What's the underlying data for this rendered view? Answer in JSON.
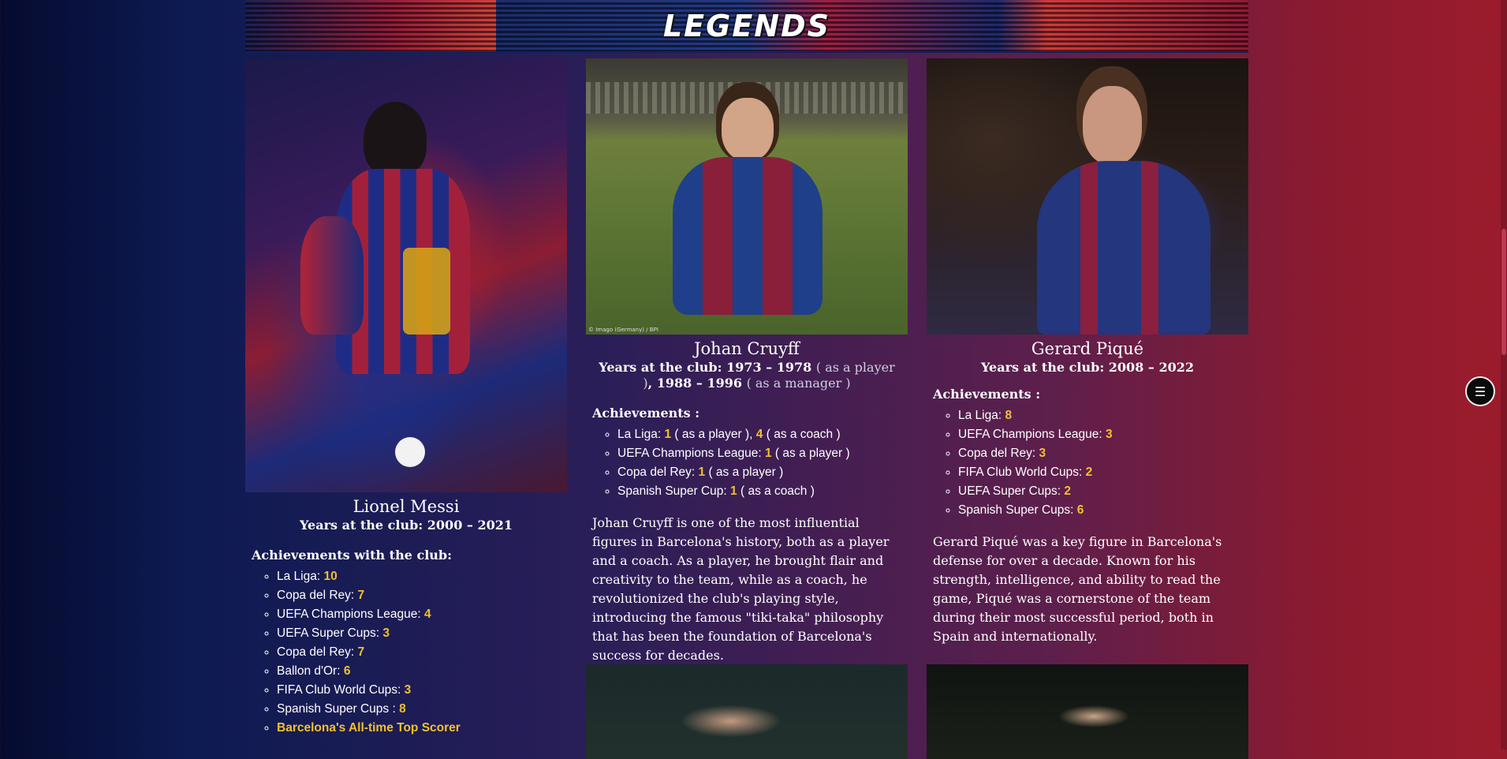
{
  "banner": {
    "title": "LEGENDS"
  },
  "legends": [
    {
      "name": "Lionel Messi",
      "years": "Years at the club: 2000 – 2021",
      "achievements_title": "Achievements with the club:",
      "achievements": [
        {
          "label": "La Liga: ",
          "value": "10"
        },
        {
          "label": "Copa del Rey: ",
          "value": "7"
        },
        {
          "label": "UEFA Champions League: ",
          "value": "4"
        },
        {
          "label": "UEFA Super Cups: ",
          "value": "3"
        },
        {
          "label": "Copa del Rey: ",
          "value": "7"
        },
        {
          "label": "Ballon d'Or: ",
          "value": "6"
        },
        {
          "label": "FIFA Club World Cups: ",
          "value": "3"
        },
        {
          "label": "Spanish Super Cups : ",
          "value": "8"
        }
      ],
      "highlight": "Barcelona's All-time Top Scorer"
    },
    {
      "name": "Johan Cruyff",
      "years_prefix": "Years at the club: 1973 – 1978",
      "years_note1": "( as a player )",
      "years_mid": ", 1988 – 1996",
      "years_note2": "( as a manager )",
      "photo_credit": "© Imago (Germany) / BPI",
      "achievements_title": "Achievements :",
      "achievements": [
        {
          "label": "La Liga: ",
          "value": "1",
          "note": "( as a player )",
          "value2": "4",
          "note2": "( as a coach )"
        },
        {
          "label": "UEFA Champions League: ",
          "value": "1",
          "note": "( as a player )"
        },
        {
          "label": "Copa del Rey: ",
          "value": "1",
          "note": "( as a player )"
        },
        {
          "label": "Spanish Super Cup: ",
          "value": "1",
          "note": "( as a coach )"
        }
      ],
      "description": "Johan Cruyff is one of the most influential figures in Barcelona's history, both as a player and a coach. As a player, he brought flair and creativity to the team, while as a coach, he revolutionized the club's playing style, introducing the famous \"tiki-taka\" philosophy that has been the foundation of Barcelona's success for decades."
    },
    {
      "name": "Gerard Piqué",
      "years": "Years at the club: 2008 – 2022",
      "achievements_title": "Achievements :",
      "achievements": [
        {
          "label": "La Liga: ",
          "value": "8"
        },
        {
          "label": "UEFA Champions League: ",
          "value": "3"
        },
        {
          "label": "Copa del Rey: ",
          "value": "3"
        },
        {
          "label": "FIFA Club World Cups: ",
          "value": "2"
        },
        {
          "label": "UEFA Super Cups: ",
          "value": "2"
        },
        {
          "label": "Spanish Super Cups: ",
          "value": "6"
        }
      ],
      "description": "Gerard Piqué was a key figure in Barcelona's defense for over a decade. Known for his strength, intelligence, and ability to read the game, Piqué was a cornerstone of the team during their most successful period, both in Spain and internationally."
    }
  ],
  "menu_icon": "menu-list-icon"
}
